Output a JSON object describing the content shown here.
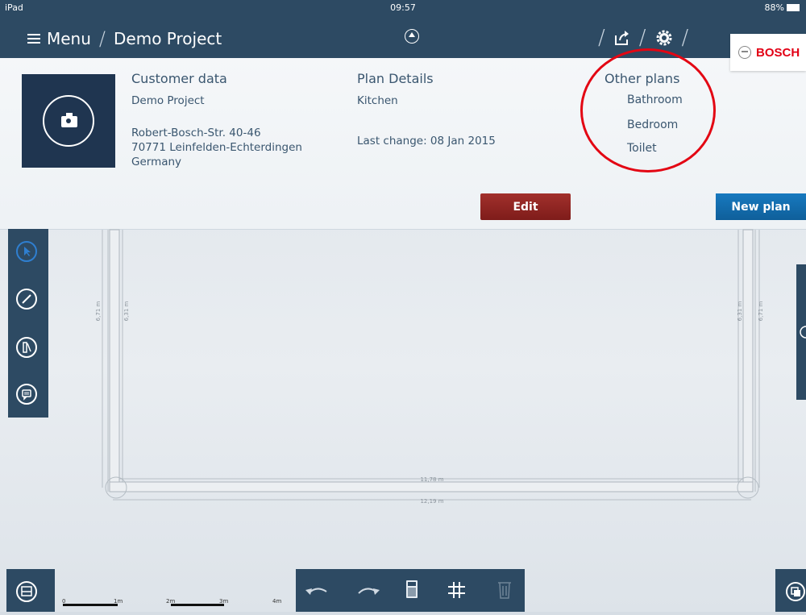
{
  "status_bar": {
    "device": "iPad",
    "time": "09:57",
    "battery": "88%"
  },
  "nav": {
    "menu_label": "Menu",
    "project_title": "Demo Project",
    "brand": "BOSCH"
  },
  "customer": {
    "heading": "Customer data",
    "project": "Demo Project",
    "address_line1": "Robert-Bosch-Str. 40-46",
    "address_line2": "70771 Leinfelden-Echterdingen",
    "country": "Germany"
  },
  "plan_details": {
    "heading": "Plan Details",
    "plan_name": "Kitchen",
    "last_change": "Last change:  08 Jan 2015"
  },
  "other_plans": {
    "heading": "Other plans",
    "items": [
      "Bathroom",
      "Bedroom",
      "Toilet"
    ]
  },
  "buttons": {
    "edit": "Edit",
    "new_plan": "New plan"
  },
  "dimensions": {
    "inner_width": "11,78 m",
    "outer_width": "12,19 m",
    "inner_height_left": "6,31 m",
    "outer_height_left": "6,71 m",
    "inner_height_right": "6,31 m",
    "outer_height_right": "6,71 m"
  },
  "scale": {
    "labels": [
      "0",
      "1m",
      "2m",
      "3m",
      "4m"
    ]
  },
  "colors": {
    "nav": "#2d4a63",
    "edit": "#8c2422",
    "new_plan": "#1470b3",
    "highlight": "#e30613",
    "brand_red": "#e20015"
  },
  "icons": {
    "left_tools": [
      "select-arrow-icon",
      "pencil-icon",
      "measure-tool-icon",
      "comment-icon"
    ],
    "bottom_tools": [
      "undo-icon",
      "redo-icon",
      "calculator-icon",
      "grid-icon",
      "trash-icon"
    ],
    "nav": [
      "share-icon",
      "settings-icon",
      "collapse-up-icon"
    ]
  }
}
